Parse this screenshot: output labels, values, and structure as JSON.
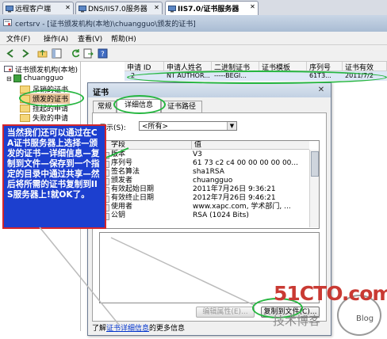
{
  "tabs": [
    {
      "label": "远程客户端"
    },
    {
      "label": "DNS/IIS7.0服务器"
    },
    {
      "label": "IIS7.0/证书服务器"
    }
  ],
  "window": {
    "title": "certsrv - [证书颁发机构(本地)\\chuangguo\\颁发的证书]"
  },
  "menu": {
    "file": "文件(F)",
    "action": "操作(A)",
    "view": "查看(V)",
    "help": "帮助(H)"
  },
  "tree": {
    "root": "证书颁发机构(本地)",
    "server": "chuangguo",
    "items": [
      "吊销的证书",
      "颁发的证书",
      "挂起的申请",
      "失败的申请"
    ]
  },
  "list": {
    "columns": [
      "申请 ID",
      "申请人姓名",
      "二进制证书",
      "证书模板",
      "序列号",
      "证书有效"
    ],
    "row": [
      "2",
      "NT AUTHOR...",
      "-----BEGI...",
      "",
      "61T3...",
      "2011/7/2"
    ]
  },
  "dialog": {
    "title": "证书",
    "tabs": [
      "常规",
      "详细信息",
      "证书路径"
    ],
    "show_label": "显示(S):",
    "show_value": "<所有>",
    "field_header": "字段",
    "value_header": "值",
    "fields": [
      {
        "f": "版本",
        "v": "V3"
      },
      {
        "f": "序列号",
        "v": "61 73 c2 c4 00 00 00 00 00..."
      },
      {
        "f": "签名算法",
        "v": "sha1RSA"
      },
      {
        "f": "颁发者",
        "v": "chuangguo"
      },
      {
        "f": "有效起始日期",
        "v": "2011年7月26日 9:36:21"
      },
      {
        "f": "有效终止日期",
        "v": "2012年7月26日 9:46:21"
      },
      {
        "f": "使用者",
        "v": "www.xapc.com, 学术部门, ..."
      },
      {
        "f": "公钥",
        "v": "RSA (1024 Bits)"
      }
    ],
    "edit_button": "编辑属性(E)...",
    "copy_button": "复制到文件(C)...",
    "learn_prefix": "了解",
    "learn_link": "证书详细信息",
    "learn_suffix": "的更多信息"
  },
  "annotation": "当然我们还可以通过在CA证书服务器上选择—颁发的证书—详细信息—复制到文件—保存到一个指定的目录中通过共享—然后将所需的证书复制到IIS服务器上!就OK了。",
  "watermark": {
    "logo": "51CTO.com",
    "sub": "技术博客",
    "blog": "Blog"
  },
  "colors": {
    "note_bg": "#1c3fcf",
    "note_border": "#d4262b",
    "highlight": "#26b640"
  }
}
